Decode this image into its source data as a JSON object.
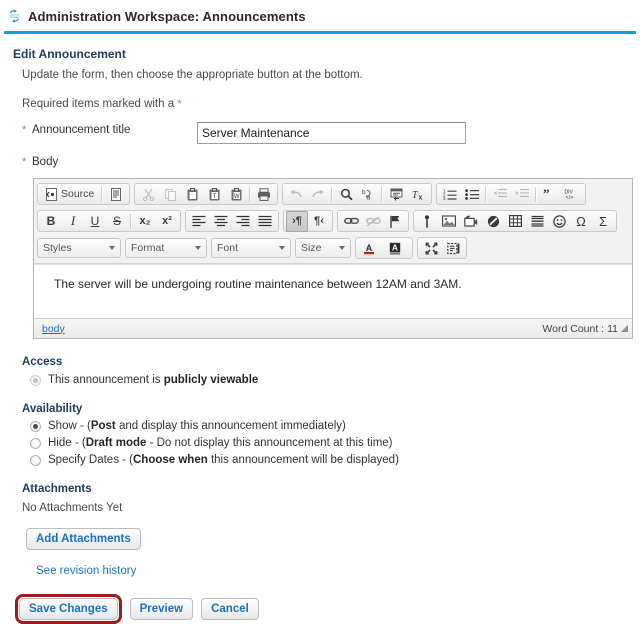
{
  "header": {
    "icon": "sync-icon",
    "title": "Administration Workspace: Announcements",
    "rule_color": "#1b9ad8"
  },
  "form": {
    "heading": "Edit Announcement",
    "instructions": "Update the form, then choose the appropriate button at the bottom.",
    "required_note": "Required items marked with a",
    "required_star": "*",
    "title_field": {
      "star": "*",
      "label": "Announcement title",
      "value": "Server Maintenance",
      "placeholder": ""
    },
    "body_field": {
      "star": "*",
      "label": "Body"
    }
  },
  "editor": {
    "toolbar_rows": [
      {
        "groups": [
          {
            "items": [
              {
                "name": "source-button",
                "label": "Source",
                "icon": "source-icon",
                "state": "enabled"
              },
              {
                "name": "templates-button",
                "label": "",
                "icon": "templates-icon",
                "state": "enabled"
              }
            ]
          },
          {
            "items": [
              {
                "name": "cut-button",
                "label": "",
                "icon": "scissors-icon",
                "state": "disabled"
              },
              {
                "name": "copy-button",
                "label": "",
                "icon": "copy-icon",
                "state": "disabled"
              },
              {
                "name": "paste-button",
                "label": "",
                "icon": "paste-icon",
                "state": "enabled"
              },
              {
                "name": "paste-as-text-button",
                "label": "",
                "icon": "paste-text-icon",
                "state": "enabled"
              },
              {
                "name": "paste-from-word-button",
                "label": "",
                "icon": "paste-word-icon",
                "state": "enabled"
              },
              {
                "name": "print-button",
                "label": "",
                "icon": "print-icon",
                "state": "enabled"
              }
            ]
          },
          {
            "items": [
              {
                "name": "undo-button",
                "label": "",
                "icon": "undo-icon",
                "state": "disabled"
              },
              {
                "name": "redo-button",
                "label": "",
                "icon": "redo-icon",
                "state": "disabled"
              },
              {
                "name": "find-button",
                "label": "",
                "icon": "magnifier-icon",
                "state": "enabled"
              },
              {
                "name": "replace-button",
                "label": "",
                "icon": "replace-icon",
                "state": "enabled"
              },
              {
                "name": "select-all-button",
                "label": "",
                "icon": "select-all-icon",
                "state": "enabled"
              },
              {
                "name": "remove-format-button",
                "label": "",
                "icon": "remove-format-icon",
                "state": "enabled"
              }
            ]
          },
          {
            "items": [
              {
                "name": "numbered-list-button",
                "label": "",
                "icon": "numbered-list-icon",
                "state": "enabled"
              },
              {
                "name": "bulleted-list-button",
                "label": "",
                "icon": "bulleted-list-icon",
                "state": "enabled"
              },
              {
                "name": "decrease-indent-button",
                "label": "",
                "icon": "outdent-icon",
                "state": "disabled"
              },
              {
                "name": "increase-indent-button",
                "label": "",
                "icon": "indent-icon",
                "state": "disabled"
              },
              {
                "name": "blockquote-button",
                "label": "",
                "icon": "quote-icon",
                "state": "enabled"
              },
              {
                "name": "create-div-button",
                "label": "",
                "icon": "div-icon",
                "state": "enabled"
              }
            ]
          }
        ]
      },
      {
        "groups": [
          {
            "items": [
              {
                "name": "bold-button",
                "label": "B",
                "icon": "bold-icon",
                "state": "enabled"
              },
              {
                "name": "italic-button",
                "label": "I",
                "icon": "italic-icon",
                "state": "enabled"
              },
              {
                "name": "underline-button",
                "label": "U",
                "icon": "underline-icon",
                "state": "enabled"
              },
              {
                "name": "strikethrough-button",
                "label": "S",
                "icon": "strikethrough-icon",
                "state": "enabled"
              },
              {
                "name": "subscript-button",
                "label": "x₂",
                "icon": "subscript-icon",
                "state": "enabled"
              },
              {
                "name": "superscript-button",
                "label": "x²",
                "icon": "superscript-icon",
                "state": "enabled"
              }
            ]
          },
          {
            "items": [
              {
                "name": "align-left-button",
                "label": "",
                "icon": "align-left-icon",
                "state": "enabled"
              },
              {
                "name": "align-center-button",
                "label": "",
                "icon": "align-center-icon",
                "state": "enabled"
              },
              {
                "name": "align-right-button",
                "label": "",
                "icon": "align-right-icon",
                "state": "enabled"
              },
              {
                "name": "align-justify-button",
                "label": "",
                "icon": "align-justify-icon",
                "state": "enabled"
              }
            ]
          },
          {
            "items": [
              {
                "name": "text-direction-ltr-button",
                "label": "",
                "icon": "ltr-icon",
                "state": "active"
              },
              {
                "name": "text-direction-rtl-button",
                "label": "",
                "icon": "rtl-icon",
                "state": "enabled"
              }
            ]
          },
          {
            "items": [
              {
                "name": "link-button",
                "label": "",
                "icon": "link-icon",
                "state": "enabled"
              },
              {
                "name": "unlink-button",
                "label": "",
                "icon": "unlink-icon",
                "state": "disabled"
              },
              {
                "name": "anchor-button",
                "label": "",
                "icon": "flag-icon",
                "state": "enabled"
              }
            ]
          },
          {
            "items": [
              {
                "name": "insert-resource-button",
                "label": "",
                "icon": "pin-icon",
                "state": "enabled"
              },
              {
                "name": "insert-image-button",
                "label": "",
                "icon": "image-icon",
                "state": "enabled"
              },
              {
                "name": "insert-movie-button",
                "label": "",
                "icon": "movie-icon",
                "state": "enabled"
              },
              {
                "name": "insert-flash-button",
                "label": "",
                "icon": "flash-icon",
                "state": "enabled"
              },
              {
                "name": "insert-table-button",
                "label": "",
                "icon": "table-icon",
                "state": "enabled"
              },
              {
                "name": "horizontal-rule-button",
                "label": "",
                "icon": "horizontal-rule-icon",
                "state": "enabled"
              },
              {
                "name": "insert-smiley-button",
                "label": "",
                "icon": "smiley-icon",
                "state": "enabled"
              },
              {
                "name": "special-character-button",
                "label": "Ω",
                "icon": "omega-icon",
                "state": "enabled"
              },
              {
                "name": "insert-formula-button",
                "label": "Σ",
                "icon": "sigma-icon",
                "state": "enabled"
              }
            ]
          }
        ]
      }
    ],
    "combos": [
      {
        "name": "styles-select",
        "label": "Styles"
      },
      {
        "name": "format-select",
        "label": "Format"
      },
      {
        "name": "font-select",
        "label": "Font"
      },
      {
        "name": "size-select",
        "label": "Size"
      }
    ],
    "color_buttons": [
      {
        "name": "text-color-button",
        "label": "A",
        "icon": "text-color-icon"
      },
      {
        "name": "background-color-button",
        "label": "A",
        "icon": "background-color-icon"
      }
    ],
    "tool_buttons": [
      {
        "name": "maximize-button",
        "icon": "maximize-icon"
      },
      {
        "name": "show-blocks-button",
        "icon": "show-blocks-icon"
      }
    ],
    "content": "The server will be undergoing routine maintenance between 12AM and 3AM.",
    "footer": {
      "element_path": "body",
      "word_count_label": "Word Count :",
      "word_count_value": "11"
    }
  },
  "access": {
    "title": "Access",
    "options": [
      {
        "name": "access-public-radio",
        "prefix": "This announcement is ",
        "strong": "publicly viewable",
        "suffix": "",
        "selected": true,
        "disabled": true
      }
    ]
  },
  "availability": {
    "title": "Availability",
    "options": [
      {
        "name": "availability-show-radio",
        "prefix": "Show - (",
        "strong": "Post",
        "suffix": " and display this announcement immediately)",
        "selected": true,
        "disabled": false
      },
      {
        "name": "availability-hide-radio",
        "prefix": "Hide - (",
        "strong": "Draft mode",
        "suffix": " - Do not display this announcement at this time)",
        "selected": false,
        "disabled": false
      },
      {
        "name": "availability-specify-dates-radio",
        "prefix": "Specify Dates - (",
        "strong": "Choose when",
        "suffix": " this announcement will be displayed)",
        "selected": false,
        "disabled": false
      }
    ]
  },
  "attachments": {
    "title": "Attachments",
    "empty_text": "No Attachments Yet",
    "add_button": "Add Attachments",
    "revision_link": "See revision history"
  },
  "actions": {
    "save": "Save Changes",
    "preview": "Preview",
    "cancel": "Cancel",
    "highlight_color": "#9e1b1b",
    "link_color": "#1a72c6"
  }
}
